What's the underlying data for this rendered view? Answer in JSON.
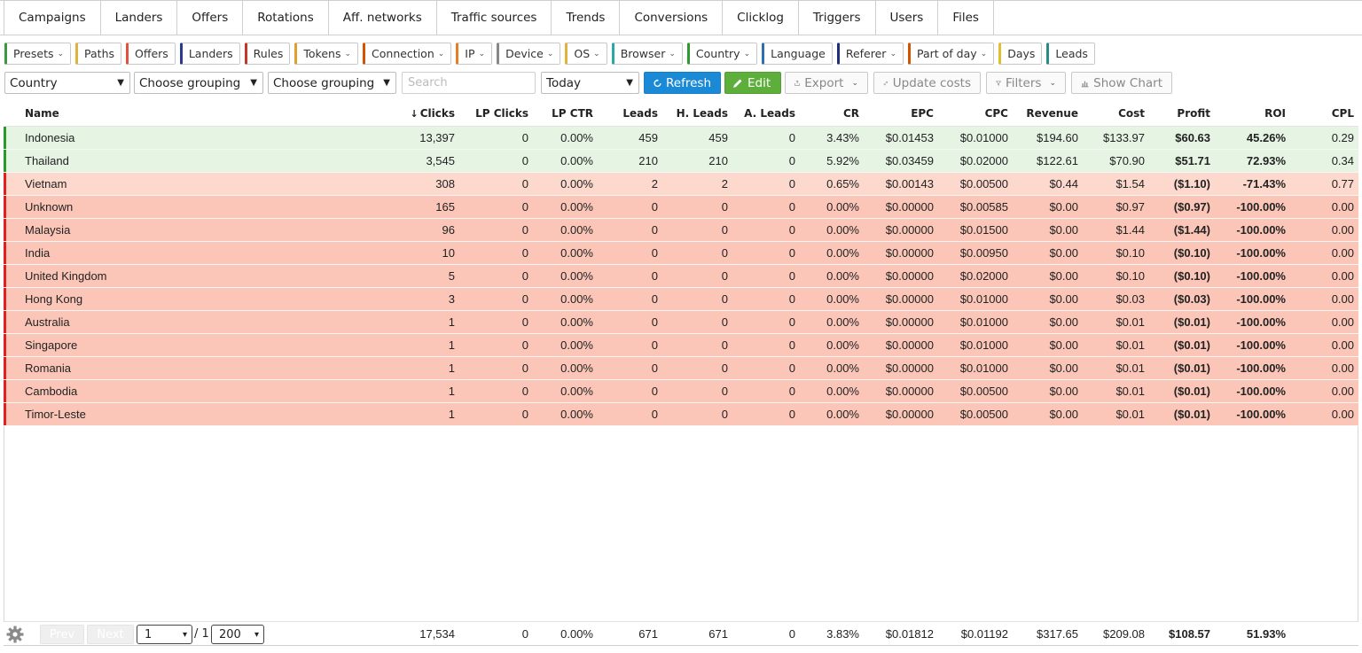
{
  "tabs": [
    "Campaigns",
    "Landers",
    "Offers",
    "Rotations",
    "Aff. networks",
    "Traffic sources",
    "Trends",
    "Conversions",
    "Clicklog",
    "Triggers",
    "Users",
    "Files"
  ],
  "filters": [
    {
      "label": "Presets",
      "caret": true,
      "color": "#3c9a3c"
    },
    {
      "label": "Paths",
      "caret": false,
      "color": "#e0b43a"
    },
    {
      "label": "Offers",
      "caret": false,
      "color": "#e0533d"
    },
    {
      "label": "Landers",
      "caret": false,
      "color": "#2b3a8c"
    },
    {
      "label": "Rules",
      "caret": false,
      "color": "#c0392b"
    },
    {
      "label": "Tokens",
      "caret": true,
      "color": "#e0a030"
    },
    {
      "label": "Connection",
      "caret": true,
      "color": "#d35400"
    },
    {
      "label": "IP",
      "caret": true,
      "color": "#e67e22"
    },
    {
      "label": "Device",
      "caret": true,
      "color": "#888888"
    },
    {
      "label": "OS",
      "caret": true,
      "color": "#e0b43a"
    },
    {
      "label": "Browser",
      "caret": true,
      "color": "#2aa8a8"
    },
    {
      "label": "Country",
      "caret": true,
      "color": "#2e9a2e"
    },
    {
      "label": "Language",
      "caret": false,
      "color": "#2e6fb0"
    },
    {
      "label": "Referer",
      "caret": true,
      "color": "#1f2f7a"
    },
    {
      "label": "Part of day",
      "caret": true,
      "color": "#d35400"
    },
    {
      "label": "Days",
      "caret": false,
      "color": "#e0c030"
    },
    {
      "label": "Leads",
      "caret": false,
      "color": "#2a8a8a"
    }
  ],
  "toolbar": {
    "grouping1": "Country",
    "grouping2": "Choose grouping",
    "grouping3": "Choose grouping",
    "search_placeholder": "Search",
    "period": "Today",
    "refresh_label": "Refresh",
    "edit_label": "Edit",
    "export_label": "Export",
    "update_costs_label": "Update costs",
    "filters_label": "Filters",
    "show_chart_label": "Show Chart"
  },
  "table": {
    "columns": [
      "Name",
      "Clicks",
      "LP Clicks",
      "LP CTR",
      "Leads",
      "H. Leads",
      "A. Leads",
      "CR",
      "EPC",
      "CPC",
      "Revenue",
      "Cost",
      "Profit",
      "ROI",
      "CPL"
    ],
    "rows": [
      {
        "status": "pos",
        "cells": [
          "Indonesia",
          "13,397",
          "0",
          "0.00%",
          "459",
          "459",
          "0",
          "3.43%",
          "$0.01453",
          "$0.01000",
          "$194.60",
          "$133.97",
          "$60.63",
          "45.26%",
          "0.29"
        ]
      },
      {
        "status": "pos",
        "cells": [
          "Thailand",
          "3,545",
          "0",
          "0.00%",
          "210",
          "210",
          "0",
          "5.92%",
          "$0.03459",
          "$0.02000",
          "$122.61",
          "$70.90",
          "$51.71",
          "72.93%",
          "0.34"
        ]
      },
      {
        "status": "neg-light",
        "cells": [
          "Vietnam",
          "308",
          "0",
          "0.00%",
          "2",
          "2",
          "0",
          "0.65%",
          "$0.00143",
          "$0.00500",
          "$0.44",
          "$1.54",
          "($1.10)",
          "-71.43%",
          "0.77"
        ]
      },
      {
        "status": "neg",
        "cells": [
          "Unknown",
          "165",
          "0",
          "0.00%",
          "0",
          "0",
          "0",
          "0.00%",
          "$0.00000",
          "$0.00585",
          "$0.00",
          "$0.97",
          "($0.97)",
          "-100.00%",
          "0.00"
        ]
      },
      {
        "status": "neg",
        "cells": [
          "Malaysia",
          "96",
          "0",
          "0.00%",
          "0",
          "0",
          "0",
          "0.00%",
          "$0.00000",
          "$0.01500",
          "$0.00",
          "$1.44",
          "($1.44)",
          "-100.00%",
          "0.00"
        ]
      },
      {
        "status": "neg",
        "cells": [
          "India",
          "10",
          "0",
          "0.00%",
          "0",
          "0",
          "0",
          "0.00%",
          "$0.00000",
          "$0.00950",
          "$0.00",
          "$0.10",
          "($0.10)",
          "-100.00%",
          "0.00"
        ]
      },
      {
        "status": "neg",
        "cells": [
          "United Kingdom",
          "5",
          "0",
          "0.00%",
          "0",
          "0",
          "0",
          "0.00%",
          "$0.00000",
          "$0.02000",
          "$0.00",
          "$0.10",
          "($0.10)",
          "-100.00%",
          "0.00"
        ]
      },
      {
        "status": "neg",
        "cells": [
          "Hong Kong",
          "3",
          "0",
          "0.00%",
          "0",
          "0",
          "0",
          "0.00%",
          "$0.00000",
          "$0.01000",
          "$0.00",
          "$0.03",
          "($0.03)",
          "-100.00%",
          "0.00"
        ]
      },
      {
        "status": "neg",
        "cells": [
          "Australia",
          "1",
          "0",
          "0.00%",
          "0",
          "0",
          "0",
          "0.00%",
          "$0.00000",
          "$0.01000",
          "$0.00",
          "$0.01",
          "($0.01)",
          "-100.00%",
          "0.00"
        ]
      },
      {
        "status": "neg",
        "cells": [
          "Singapore",
          "1",
          "0",
          "0.00%",
          "0",
          "0",
          "0",
          "0.00%",
          "$0.00000",
          "$0.01000",
          "$0.00",
          "$0.01",
          "($0.01)",
          "-100.00%",
          "0.00"
        ]
      },
      {
        "status": "neg",
        "cells": [
          "Romania",
          "1",
          "0",
          "0.00%",
          "0",
          "0",
          "0",
          "0.00%",
          "$0.00000",
          "$0.01000",
          "$0.00",
          "$0.01",
          "($0.01)",
          "-100.00%",
          "0.00"
        ]
      },
      {
        "status": "neg",
        "cells": [
          "Cambodia",
          "1",
          "0",
          "0.00%",
          "0",
          "0",
          "0",
          "0.00%",
          "$0.00000",
          "$0.00500",
          "$0.00",
          "$0.01",
          "($0.01)",
          "-100.00%",
          "0.00"
        ]
      },
      {
        "status": "neg",
        "cells": [
          "Timor-Leste",
          "1",
          "0",
          "0.00%",
          "0",
          "0",
          "0",
          "0.00%",
          "$0.00000",
          "$0.00500",
          "$0.00",
          "$0.01",
          "($0.01)",
          "-100.00%",
          "0.00"
        ]
      }
    ]
  },
  "footer": {
    "prev_label": "Prev",
    "next_label": "Next",
    "page": "1",
    "total_pages": "/ 1",
    "page_size": "200",
    "totals": [
      "17,534",
      "0",
      "0.00%",
      "671",
      "671",
      "0",
      "3.83%",
      "$0.01812",
      "$0.01192",
      "$317.65",
      "$209.08",
      "$108.57",
      "51.93%"
    ]
  },
  "icons": {
    "settings": "gear-icon",
    "refresh": "refresh-icon",
    "edit": "pencil-icon",
    "export": "export-icon",
    "update_costs": "link-icon",
    "filters": "funnel-icon",
    "chart": "bar-chart-icon",
    "sort": "sort-down-arrow-icon"
  },
  "colors": {
    "positive": "#38962f",
    "negative": "#cc1f1f",
    "refresh_button": "#1a8ad6",
    "edit_button": "#5eae3c"
  }
}
